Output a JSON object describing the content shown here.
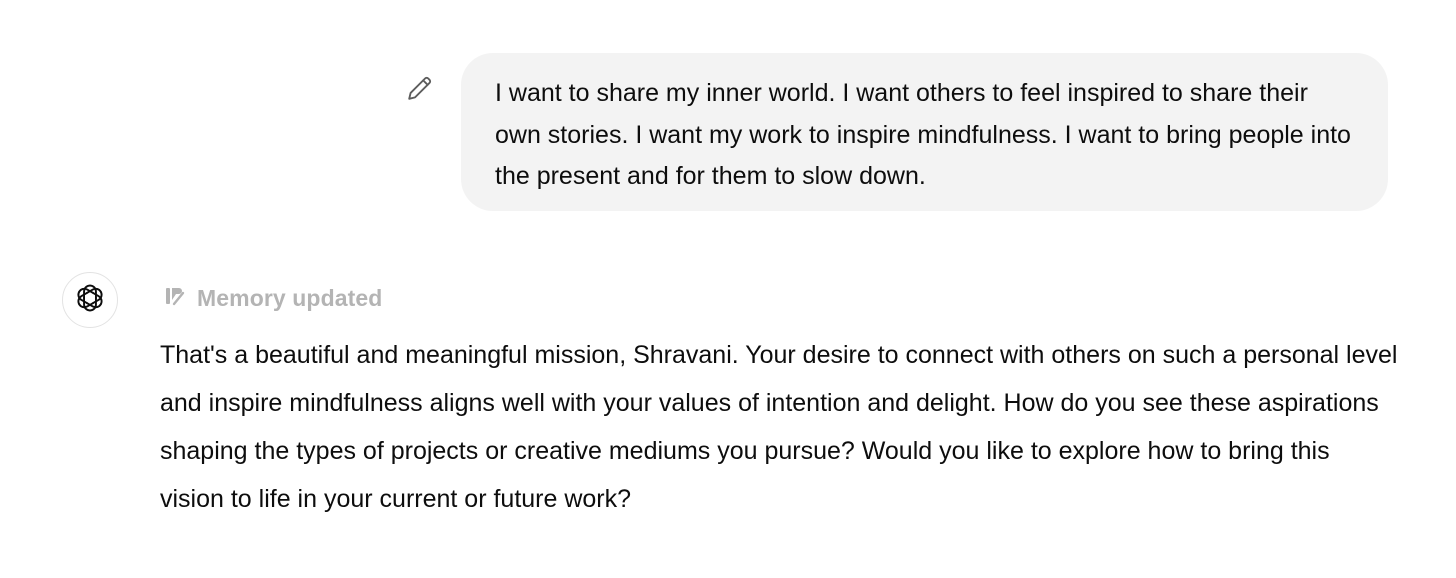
{
  "conversation": {
    "user_message": {
      "text": "I want to share my inner world. I want others to feel inspired to share their own stories. I want my work to inspire mindfulness. I want to bring people into the present and for them to slow down.",
      "edit_icon": "pencil-icon",
      "bubble_color": "#f3f3f3"
    },
    "assistant_message": {
      "avatar_icon": "openai-logo-icon",
      "status": {
        "icon": "memory-icon",
        "label": "Memory updated",
        "color": "#b4b4b4"
      },
      "text": "That's a beautiful and meaningful mission, Shravani. Your desire to connect with others on such a personal level and inspire mindfulness aligns well with your values of intention and delight. How do you see these aspirations shaping the types of projects or creative mediums you pursue? Would you like to explore how to bring this vision to life in your current or future work?"
    }
  }
}
